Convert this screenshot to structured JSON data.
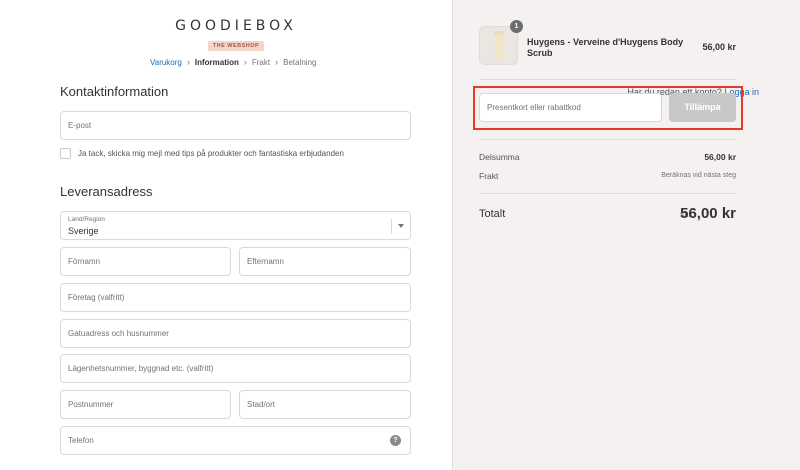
{
  "brand": {
    "name": "GOODIEBOX",
    "tagline": "THE WEBSHOP"
  },
  "breadcrumbs": [
    {
      "label": "Varukorg",
      "state": "link"
    },
    {
      "label": "Information",
      "state": "current"
    },
    {
      "label": "Frakt",
      "state": "upcoming"
    },
    {
      "label": "Betalning",
      "state": "upcoming"
    }
  ],
  "contact": {
    "title": "Kontaktinformation",
    "login_prompt": "Har du redan ett konto?",
    "login_link": "Logga in",
    "email_placeholder": "E-post",
    "newsletter_label": "Ja tack, skicka mig mejl med tips på produkter och fantastiska erbjudanden"
  },
  "shipping": {
    "title": "Leveransadress",
    "country_label": "Land/Region",
    "country_value": "Sverige",
    "first_name": "Förnamn",
    "last_name": "Efternamn",
    "company": "Företag (valfritt)",
    "address": "Gatuadress och husnummer",
    "apartment": "Lägenhetsnummer, byggnad etc. (valfritt)",
    "postal_code": "Postnummer",
    "city": "Stad/ort",
    "phone": "Telefon"
  },
  "cart": {
    "product_name": "Huygens - Verveine d'Huygens Body Scrub",
    "product_qty": "1",
    "product_price": "56,00 kr",
    "discount_placeholder": "Presentkort eller rabattkod",
    "apply_label": "Tillämpa",
    "subtotal_label": "Delsumma",
    "subtotal_value": "56,00 kr",
    "shipping_label": "Frakt",
    "shipping_value": "Beräknas vid nästa steg",
    "total_label": "Totalt",
    "total_currency": "SEK",
    "total_value": "56,00 kr"
  },
  "colors": {
    "accent_link": "#1f6ab5",
    "highlight_border": "#e53a2c",
    "sidebar_bg": "#f4f1f0",
    "button_disabled": "#c8c8c8"
  },
  "icons": {
    "help": "question-circle-icon",
    "dropdown": "chevron-down-icon",
    "product_image": "body-scrub-tube"
  }
}
